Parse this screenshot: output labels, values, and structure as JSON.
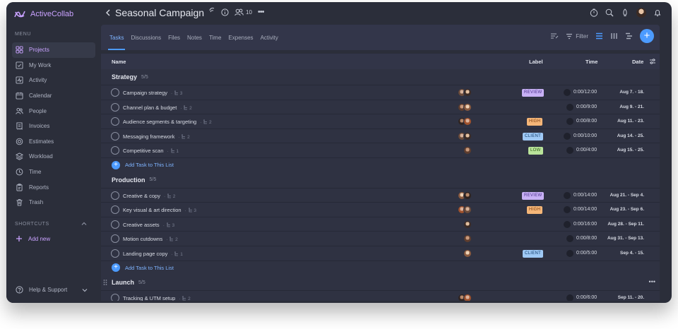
{
  "app": {
    "brand": "ActiveCollab"
  },
  "sidebar": {
    "menu_label": "MENU",
    "items": [
      {
        "label": "Projects",
        "icon": "projects-icon",
        "active": true
      },
      {
        "label": "My Work",
        "icon": "my-work-icon"
      },
      {
        "label": "Activity",
        "icon": "activity-icon"
      },
      {
        "label": "Calendar",
        "icon": "calendar-icon"
      },
      {
        "label": "People",
        "icon": "people-icon"
      },
      {
        "label": "Invoices",
        "icon": "invoices-icon"
      },
      {
        "label": "Estimates",
        "icon": "estimates-icon"
      },
      {
        "label": "Workload",
        "icon": "workload-icon"
      },
      {
        "label": "Time",
        "icon": "time-icon"
      },
      {
        "label": "Reports",
        "icon": "reports-icon"
      },
      {
        "label": "Trash",
        "icon": "trash-icon"
      }
    ],
    "shortcuts_label": "SHORTCUTS",
    "add_new": "Add new",
    "help": "Help & Support"
  },
  "header": {
    "title": "Seasonal Campaign",
    "people_count": "10"
  },
  "tabs": [
    "Tasks",
    "Discussions",
    "Files",
    "Notes",
    "Time",
    "Expenses",
    "Activity"
  ],
  "active_tab": "Tasks",
  "toolbar": {
    "filter_label": "Filter"
  },
  "table": {
    "columns": {
      "name": "Name",
      "label": "Label",
      "time": "Time",
      "date": "Date"
    },
    "add_task": "Add Task to This List",
    "groups": [
      {
        "name": "Strategy",
        "count": "5/5",
        "tasks": [
          {
            "name": "Campaign strategy",
            "subtasks": "3",
            "label": "REVIEW",
            "time": "0:00/12:00",
            "date": "Aug 7. - 18."
          },
          {
            "name": "Channel plan & budget",
            "subtasks": "2",
            "label": "",
            "time": "0:00/9:00",
            "date": "Aug 9. - 21."
          },
          {
            "name": "Audience segments & targeting",
            "subtasks": "2",
            "label": "HIGH",
            "time": "0:00/8:00",
            "date": "Aug 11. - 23."
          },
          {
            "name": "Messaging framework",
            "subtasks": "2",
            "label": "CLIENT",
            "time": "0:00/10:00",
            "date": "Aug 14. - 25."
          },
          {
            "name": "Competitive scan",
            "subtasks": "1",
            "label": "LOW",
            "time": "0:00/4:00",
            "date": "Aug 15. - 25."
          }
        ]
      },
      {
        "name": "Production",
        "count": "5/5",
        "tasks": [
          {
            "name": "Creative & copy",
            "subtasks": "2",
            "label": "REVIEW",
            "time": "0:00/14:00",
            "date": "Aug 21. - Sep 4."
          },
          {
            "name": "Key visual & art direction",
            "subtasks": "3",
            "label": "HIGH",
            "time": "0:00/14:00",
            "date": "Aug 23. - Sep 6."
          },
          {
            "name": "Creative assets",
            "subtasks": "3",
            "label": "",
            "time": "0:00/16:00",
            "date": "Aug 28. - Sep 11."
          },
          {
            "name": "Motion cutdowns",
            "subtasks": "2",
            "label": "",
            "time": "0:00/8:00",
            "date": "Aug 31. - Sep 13."
          },
          {
            "name": "Landing page copy",
            "subtasks": "1",
            "label": "CLIENT",
            "time": "0:00/5:00",
            "date": "Sep 4. - 15."
          }
        ]
      },
      {
        "name": "Launch",
        "count": "5/5",
        "tasks": [
          {
            "name": "Tracking & UTM setup",
            "subtasks": "2",
            "label": "",
            "time": "0:00/6:00",
            "date": "Sep 11. - 20."
          }
        ]
      }
    ]
  },
  "label_colors": {
    "REVIEW": {
      "bg": "#c8b1f5",
      "fg": "#4a2f8a"
    },
    "HIGH": {
      "bg": "#f5b678",
      "fg": "#7a3b0b"
    },
    "CLIENT": {
      "bg": "#9fc9f5",
      "fg": "#123e6e"
    },
    "LOW": {
      "bg": "#b9e39a",
      "fg": "#2d5a12"
    }
  }
}
